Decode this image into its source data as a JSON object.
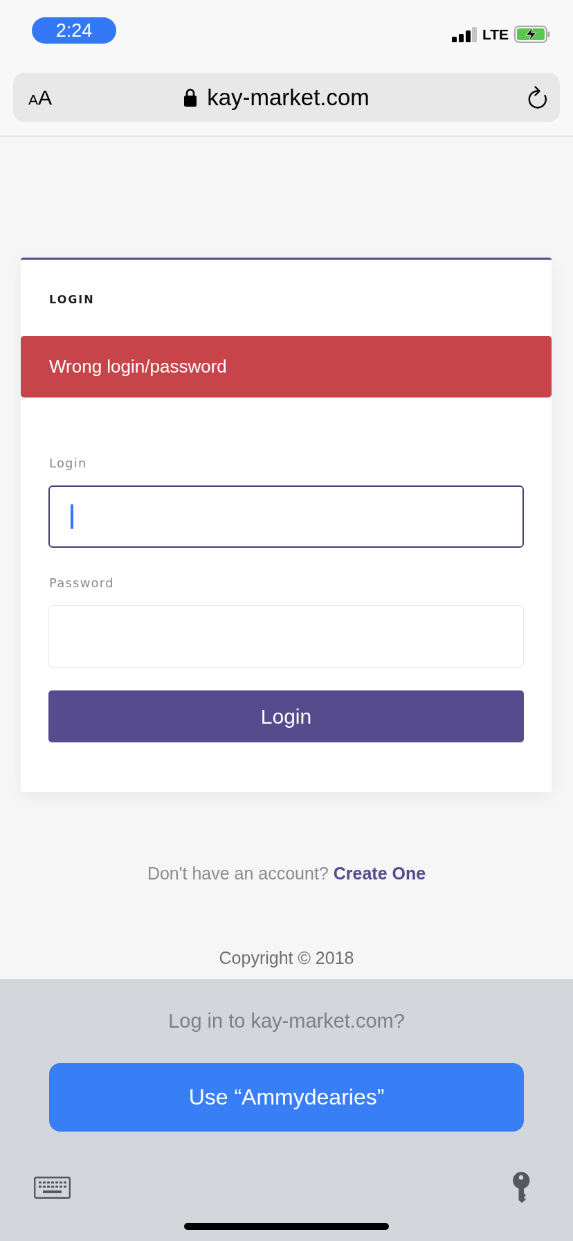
{
  "status_bar": {
    "time": "2:24",
    "network": "LTE"
  },
  "address_bar": {
    "text_size_button": {
      "small": "A",
      "large": "A"
    },
    "secure": true,
    "url": "kay-market.com"
  },
  "login_card": {
    "title": "LOGIN",
    "alert": "Wrong login/password",
    "fields": [
      {
        "label": "Login",
        "focused": true
      },
      {
        "label": "Password",
        "focused": false
      }
    ],
    "submit_button": "Login"
  },
  "signup": {
    "prompt": "Don't have an account?",
    "link": "Create One"
  },
  "footer": {
    "copyright": "Copyright © 2018"
  },
  "password_autofill": {
    "question": "Log in to kay-market.com?",
    "suggestion_button": "Use “Ammydearies”"
  }
}
